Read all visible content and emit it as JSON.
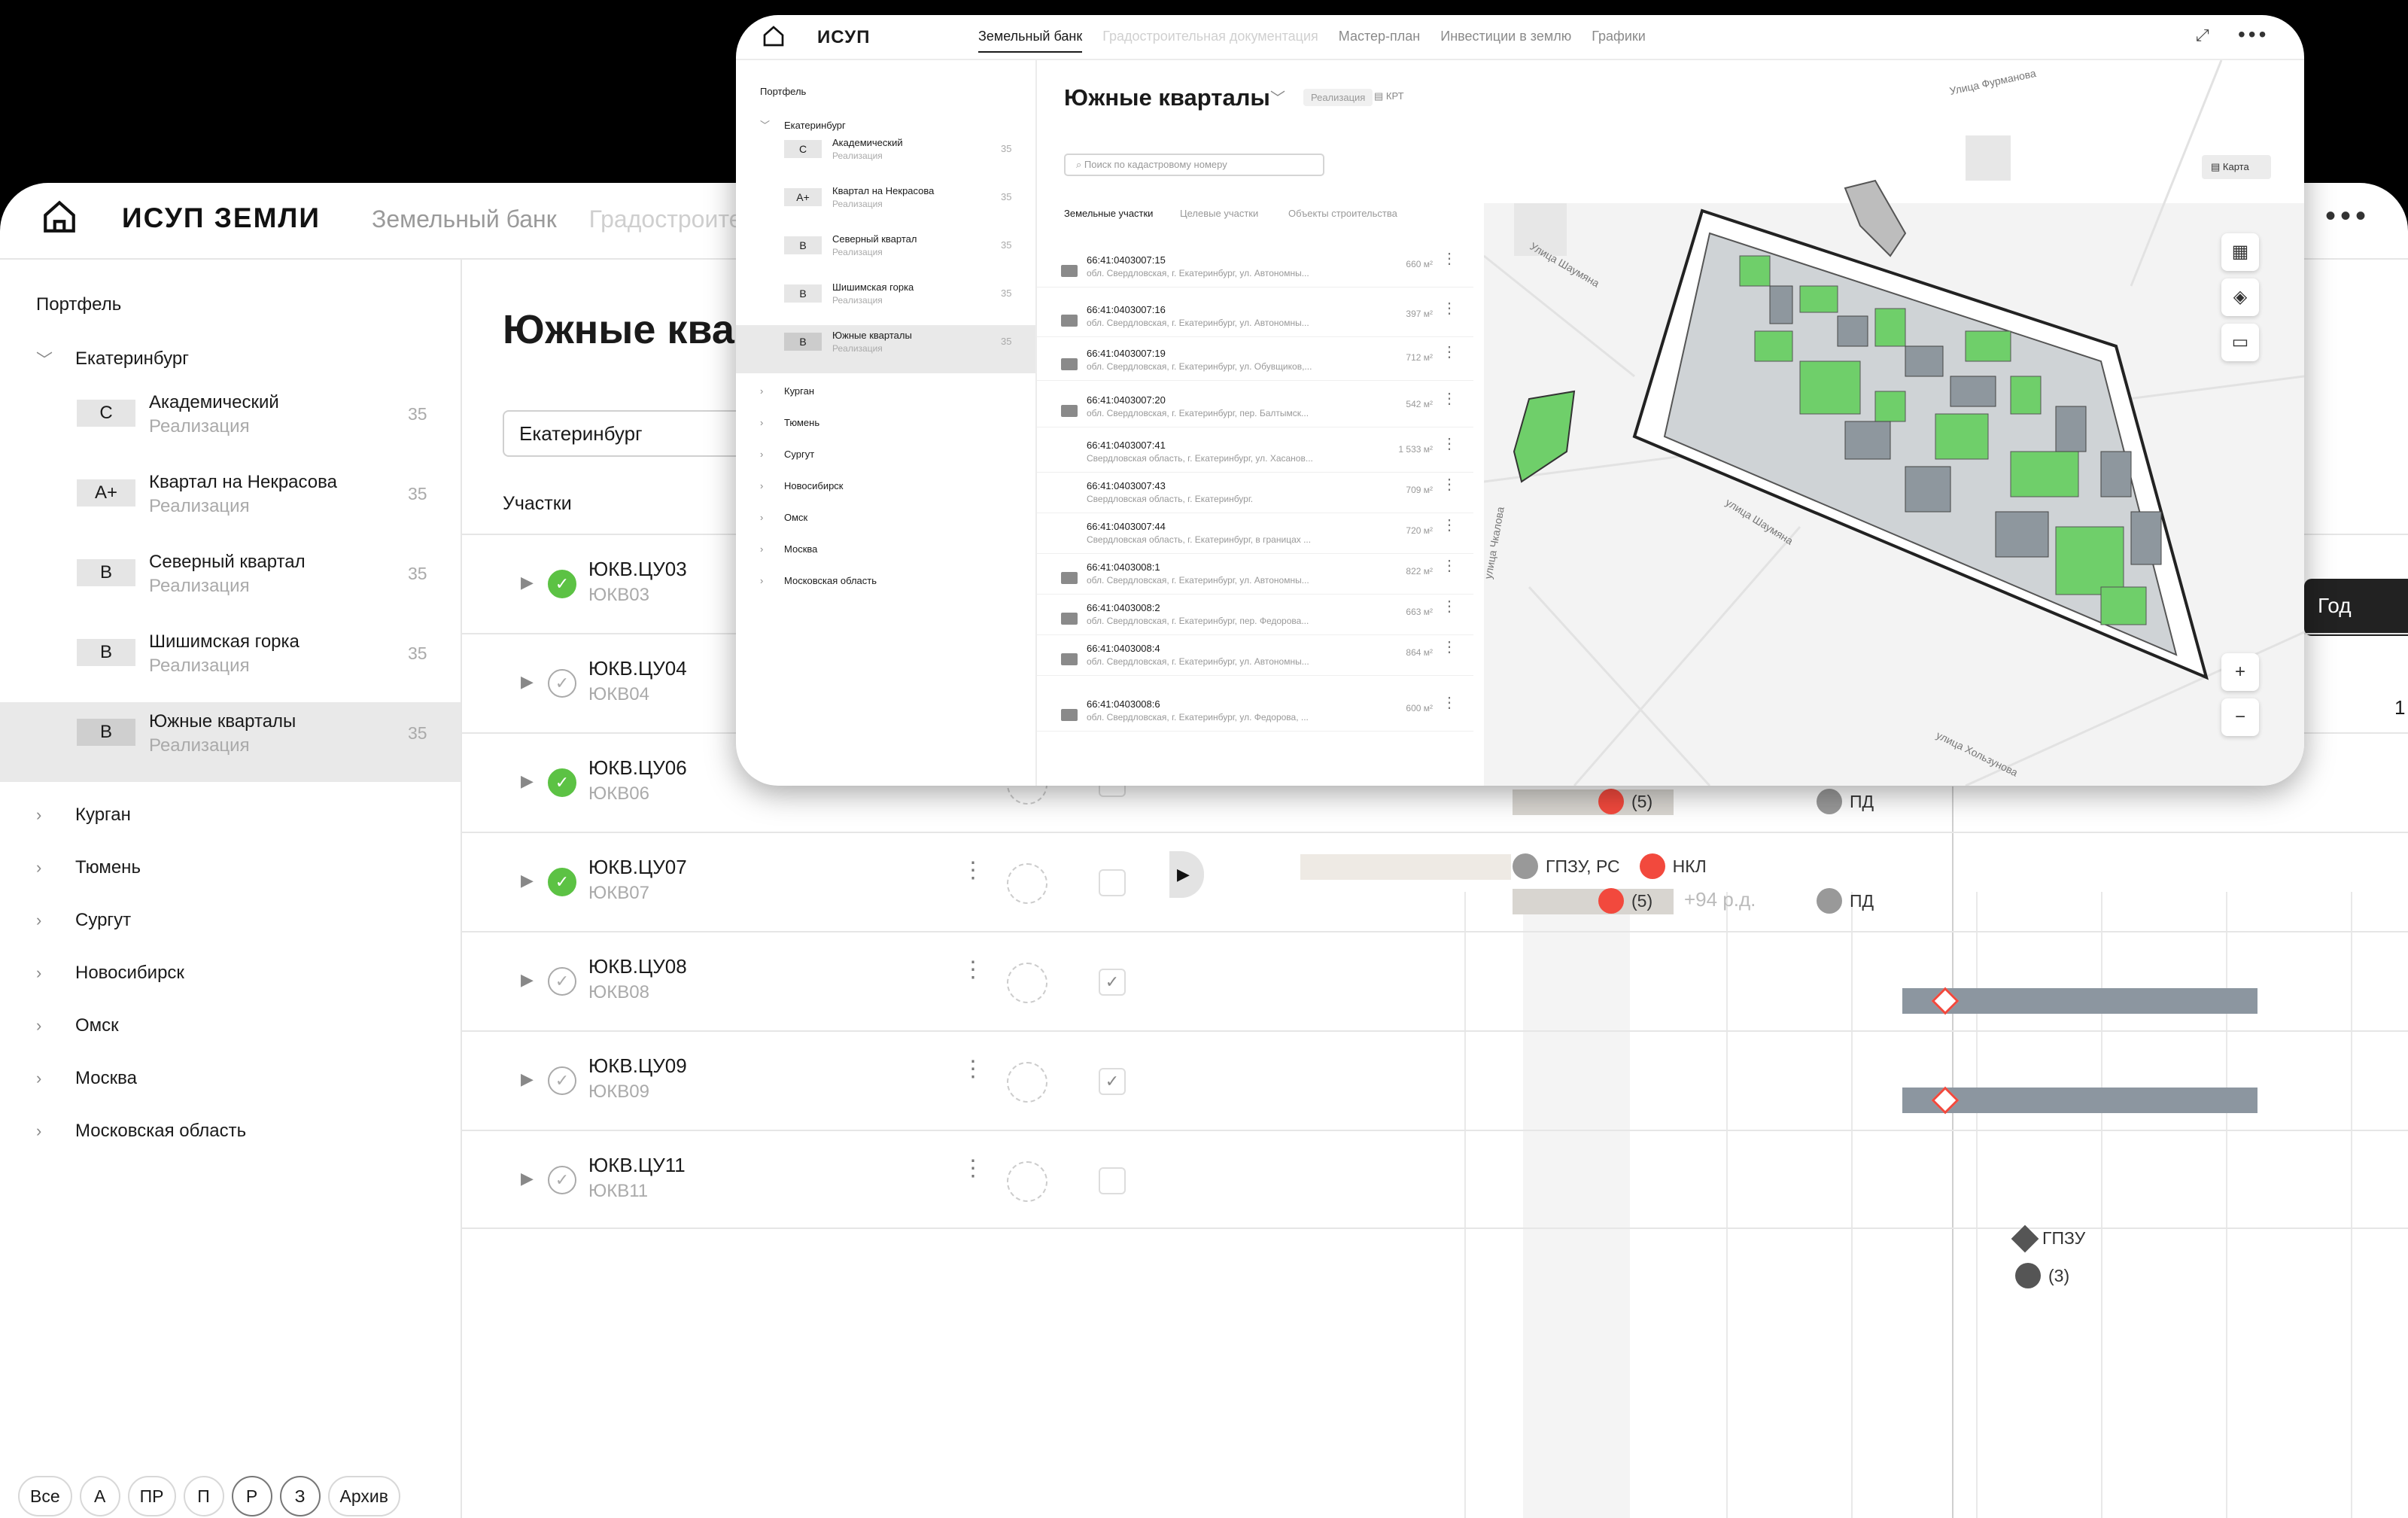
{
  "back_app": {
    "logo": "ИСУП ЗЕМЛИ",
    "tabs": [
      "Земельный банк",
      "Градостроител"
    ],
    "sidebar": {
      "heading": "Портфель",
      "expanded_city": "Екатеринбург",
      "projects": [
        {
          "badge": "C",
          "name": "Академический",
          "status": "Реализация",
          "count": "35"
        },
        {
          "badge": "A+",
          "name": "Квартал на Некрасова",
          "status": "Реализация",
          "count": "35"
        },
        {
          "badge": "B",
          "name": "Северный квартал",
          "status": "Реализация",
          "count": "35"
        },
        {
          "badge": "B",
          "name": "Шишимская горка",
          "status": "Реализация",
          "count": "35"
        },
        {
          "badge": "B",
          "name": "Южные кварталы",
          "status": "Реализация",
          "count": "35"
        }
      ],
      "cities": [
        "Курган",
        "Тюмень",
        "Сургут",
        "Новосибирск",
        "Омск",
        "Москва",
        "Московская область"
      ],
      "filters": [
        "Все",
        "А",
        "ПР",
        "П",
        "Р",
        "З",
        "Архив"
      ]
    },
    "main": {
      "title": "Южные квар",
      "select_value": "Екатеринбург",
      "section_label": "Участки",
      "year_button": "Год",
      "header_value": "1",
      "rows": [
        {
          "code": "ЮКВ.ЦУ03",
          "sub": "ЮКВ03",
          "ok": true,
          "checked": false
        },
        {
          "code": "ЮКВ.ЦУ04",
          "sub": "ЮКВ04",
          "ok": false,
          "checked": false
        },
        {
          "code": "ЮКВ.ЦУ06",
          "sub": "ЮКВ06",
          "ok": true,
          "checked": false
        },
        {
          "code": "ЮКВ.ЦУ07",
          "sub": "ЮКВ07",
          "ok": true,
          "checked": false
        },
        {
          "code": "ЮКВ.ЦУ08",
          "sub": "ЮКВ08",
          "ok": false,
          "checked": true
        },
        {
          "code": "ЮКВ.ЦУ09",
          "sub": "ЮКВ09",
          "ok": false,
          "checked": true
        },
        {
          "code": "ЮКВ.ЦУ11",
          "sub": "ЮКВ11",
          "ok": false,
          "checked": false
        }
      ],
      "gantt": {
        "tag_5": "(5)",
        "tag_pd": "ПД",
        "tag_gpzu_rs": "ГПЗУ, РС",
        "tag_nkl": "НКЛ",
        "tag_plus": "+94 р.д.",
        "tag_gpzu": "ГПЗУ",
        "tag_3": "(3)"
      }
    }
  },
  "front_app": {
    "logo": "ИСУП",
    "tabs": [
      "Земельный банк",
      "Градостроительная документация",
      "Мастер-план",
      "Инвестиции в землю",
      "Графики"
    ],
    "active_tab": "Земельный банк",
    "sidebar": {
      "heading": "Портфель",
      "expanded_city": "Екатеринбург",
      "projects": [
        {
          "badge": "C",
          "name": "Академический",
          "status": "Реализация",
          "count": "35"
        },
        {
          "badge": "A+",
          "name": "Квартал на Некрасова",
          "status": "Реализация",
          "count": "35"
        },
        {
          "badge": "B",
          "name": "Северный квартал",
          "status": "Реализация",
          "count": "35"
        },
        {
          "badge": "B",
          "name": "Шишимская горка",
          "status": "Реализация",
          "count": "35"
        },
        {
          "badge": "B",
          "name": "Южные кварталы",
          "status": "Реализация",
          "count": "35"
        }
      ],
      "cities": [
        "Курган",
        "Тюмень",
        "Сургут",
        "Новосибирск",
        "Омск",
        "Москва",
        "Московская область"
      ]
    },
    "project": {
      "title": "Южные кварталы",
      "status": "Реализация",
      "krt": "КРТ",
      "search_placeholder": "Поиск по кадастровому номеру",
      "tabs": [
        "Земельные участки",
        "Целевые участки",
        "Объекты строительства"
      ],
      "plots": [
        {
          "num": "66:41:0403007:15",
          "addr": "обл. Свердловская, г. Екатеринбург, ул. Автономны...",
          "area": "660 м²"
        },
        {
          "num": "66:41:0403007:16",
          "addr": "обл. Свердловская, г. Екатеринбург, ул. Автономны...",
          "area": "397 м²"
        },
        {
          "num": "66:41:0403007:19",
          "addr": "обл. Свердловская, г. Екатеринбург, ул. Обувщиков,...",
          "area": "712 м²"
        },
        {
          "num": "66:41:0403007:20",
          "addr": "обл. Свердловская, г. Екатеринбург, пер. Балтымск...",
          "area": "542 м²"
        },
        {
          "num": "66:41:0403007:41",
          "addr": "Свердловская область, г. Екатеринбург, ул. Хасанов...",
          "area": "1 533 м²"
        },
        {
          "num": "66:41:0403007:43",
          "addr": "Свердловская область, г. Екатеринбург.",
          "area": "709 м²"
        },
        {
          "num": "66:41:0403007:44",
          "addr": "Свердловская область, г. Екатеринбург, в границах ...",
          "area": "720 м²"
        },
        {
          "num": "66:41:0403008:1",
          "addr": "обл. Свердловская, г. Екатеринбург, ул. Автономны...",
          "area": "822 м²"
        },
        {
          "num": "66:41:0403008:2",
          "addr": "обл. Свердловская, г. Екатеринбург, пер. Федорова...",
          "area": "663 м²"
        },
        {
          "num": "66:41:0403008:4",
          "addr": "обл. Свердловская, г. Екатеринбург, ул. Автономны...",
          "area": "864 м²"
        },
        {
          "num": "66:41:0403008:6",
          "addr": "обл. Свердловская, г. Екатеринбург, ул. Федорова, ...",
          "area": "600 м²"
        }
      ]
    },
    "map": {
      "button": "Карта",
      "streets": [
        "Улица Фурманова",
        "Улица Шаумяна",
        "улица Шаумяна",
        "улица Чкалова",
        "улица Хользунова"
      ],
      "zoom_in": "+",
      "zoom_out": "−"
    }
  },
  "colors": {
    "green": "#6fcf6a",
    "gray_block": "#8e979e",
    "red": "#f2493d",
    "ok_green": "#5cc244"
  }
}
